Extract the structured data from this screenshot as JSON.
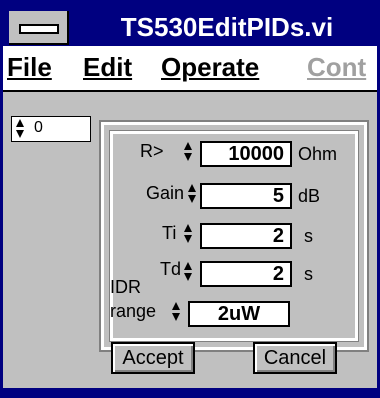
{
  "window": {
    "title": "TS530EditPIDs.vi"
  },
  "menu": {
    "file": "File",
    "edit": "Edit",
    "operate": "Operate",
    "controls": "Cont"
  },
  "index_value": "0",
  "params": {
    "r": {
      "label": "R>",
      "value": "10000",
      "unit": "Ohm"
    },
    "gain": {
      "label": "Gain",
      "value": "5",
      "unit": "dB"
    },
    "ti": {
      "label": "Ti",
      "value": "2",
      "unit": "s"
    },
    "td": {
      "label": "Td",
      "value": "2",
      "unit": "s"
    },
    "idr": {
      "label1": "IDR",
      "label2": "range",
      "value": "2uW"
    }
  },
  "buttons": {
    "accept": "Accept",
    "cancel": "Cancel"
  }
}
